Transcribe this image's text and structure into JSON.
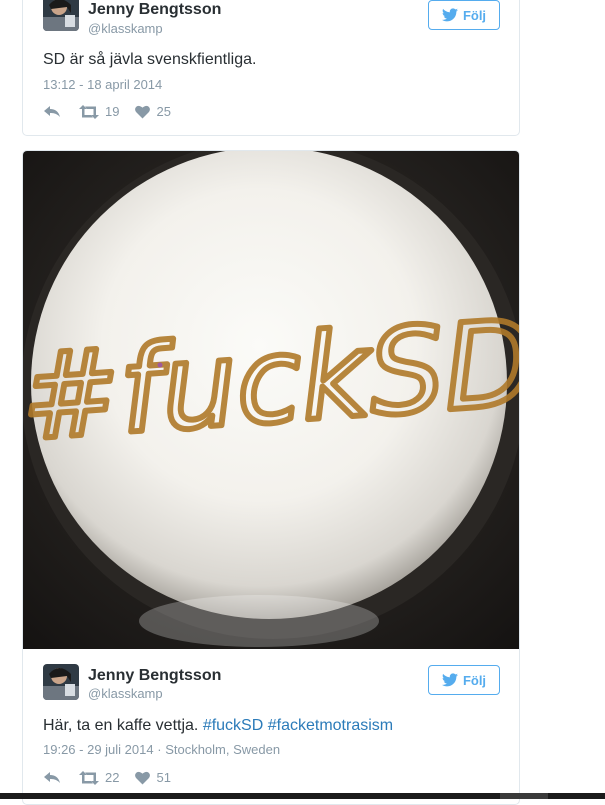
{
  "tweets": [
    {
      "name": "Jenny Bengtsson",
      "handle": "@klasskamp",
      "follow_label": "Följ",
      "text": "SD är så jävla svenskfientliga.",
      "timestamp": "13:12 - 18 april 2014",
      "retweets": "19",
      "likes": "25"
    },
    {
      "name": "Jenny Bengtsson",
      "handle": "@klasskamp",
      "follow_label": "Följ",
      "text": "Här, ta en kaffe vettja.",
      "hashtags": [
        "#fuckSD",
        "#facketmotrasism"
      ],
      "timestamp": "19:26 - 29 juli 2014",
      "separator": "·",
      "location": "Stockholm, Sweden",
      "retweets": "22",
      "likes": "51",
      "photo_text": "#fuckSD"
    }
  ],
  "colors": {
    "accent": "#55acee",
    "hashtag": "#2b7bb9",
    "muted": "#8899a6",
    "text": "#292f33",
    "border": "#e1e8ed"
  },
  "icons": {
    "follow": "twitter-bird-icon",
    "reply": "reply-icon",
    "retweet": "retweet-icon",
    "like": "heart-icon"
  }
}
